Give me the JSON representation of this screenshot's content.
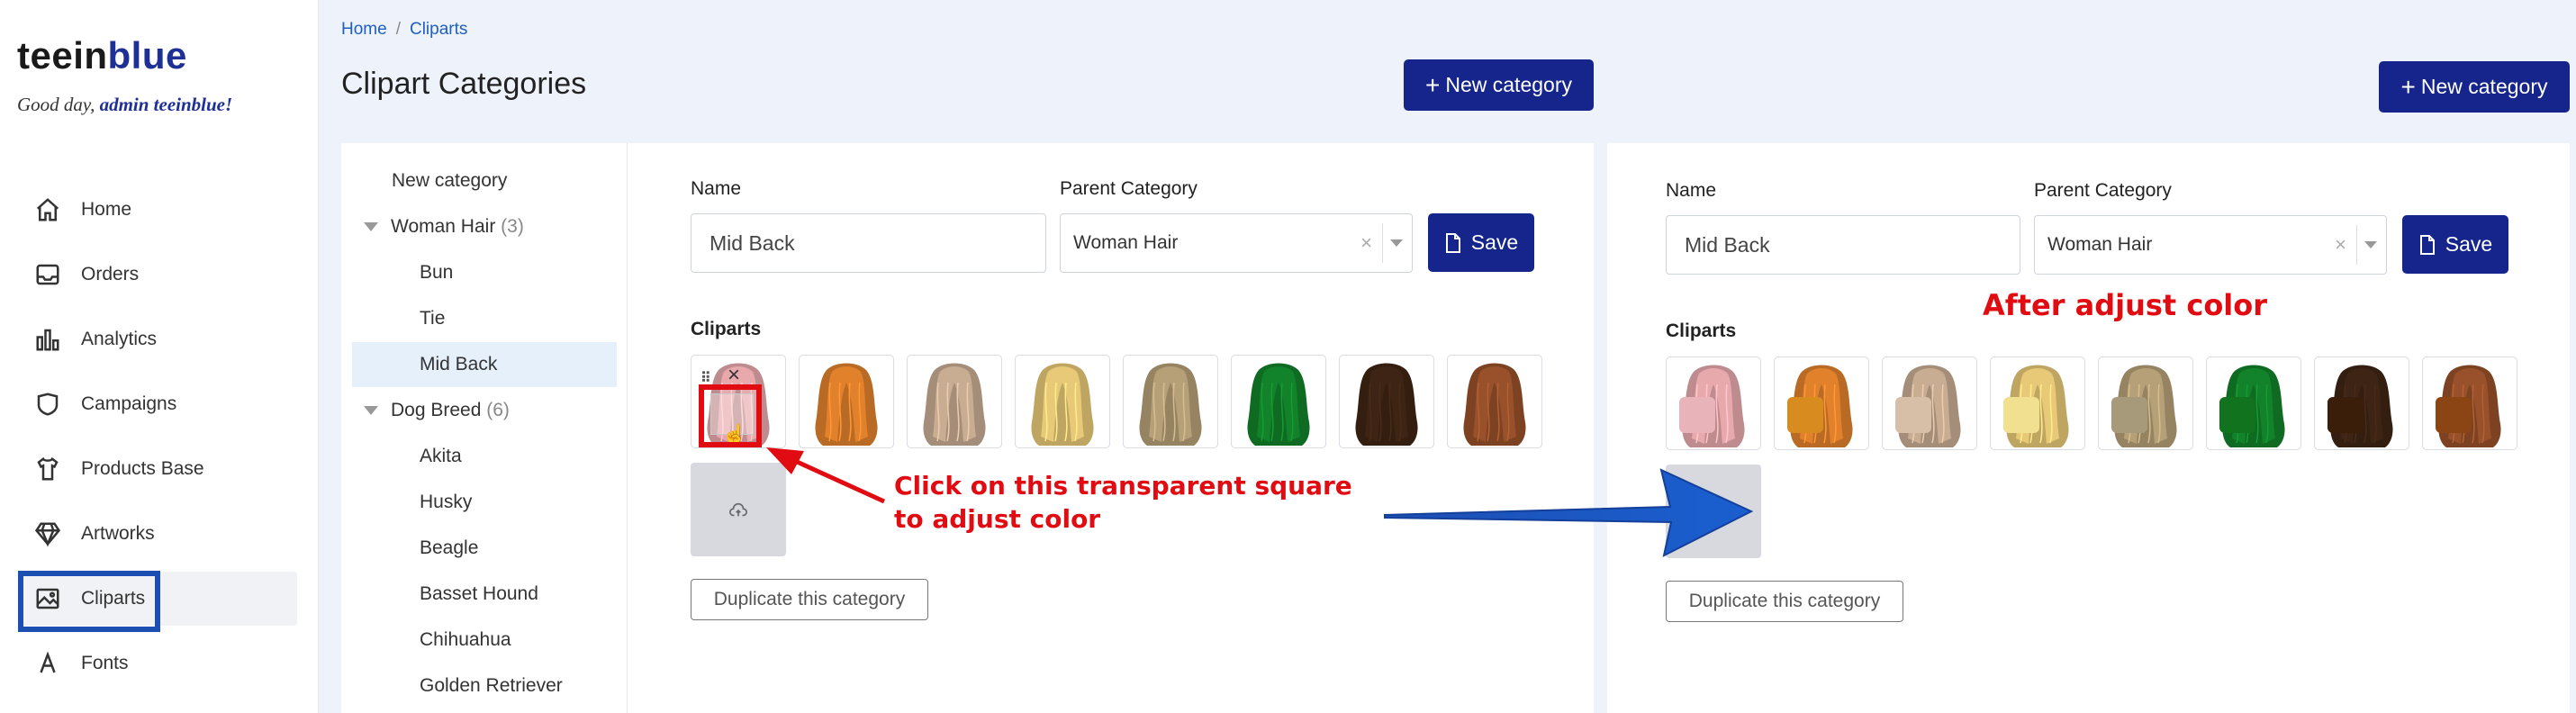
{
  "brand": {
    "part1": "teein",
    "part2": "blue"
  },
  "greeting": {
    "prefix": "Good day, ",
    "user": "admin teeinblue!"
  },
  "nav": [
    {
      "label": "Home",
      "icon": "home-icon"
    },
    {
      "label": "Orders",
      "icon": "inbox-icon"
    },
    {
      "label": "Analytics",
      "icon": "bar-chart-icon"
    },
    {
      "label": "Campaigns",
      "icon": "campaign-icon"
    },
    {
      "label": "Products Base",
      "icon": "shirt-icon"
    },
    {
      "label": "Artworks",
      "icon": "gem-icon"
    },
    {
      "label": "Cliparts",
      "icon": "image-icon",
      "active": true
    },
    {
      "label": "Fonts",
      "icon": "font-icon"
    }
  ],
  "breadcrumb": {
    "home": "Home",
    "sep": "/",
    "current": "Cliparts"
  },
  "page_title": "Clipart Categories",
  "new_category_button": "New category",
  "tree": {
    "new_category": "New category",
    "groups": [
      {
        "label": "Woman Hair",
        "count": "(3)",
        "children": [
          "Bun",
          "Tie",
          "Mid Back"
        ]
      },
      {
        "label": "Dog Breed",
        "count": "(6)",
        "children": [
          "Akita",
          "Husky",
          "Beagle",
          "Basset Hound",
          "Chihuahua",
          "Golden Retriever"
        ]
      }
    ],
    "selected": "Mid Back"
  },
  "form": {
    "name_label": "Name",
    "name_value": "Mid Back",
    "parent_label": "Parent Category",
    "parent_value": "Woman Hair",
    "clear_symbol": "×",
    "save_label": "Save",
    "cliparts_label": "Cliparts",
    "duplicate_label": "Duplicate this category"
  },
  "hair_colors": [
    "#e8a9ad",
    "#e2812c",
    "#c9ad93",
    "#e8c977",
    "#b6a078",
    "#12832a",
    "#3e2414",
    "#98512a"
  ],
  "adjusted_swatches": [
    "#e9b4b9",
    "#d88b1e",
    "#d6bfa6",
    "#f0e08f",
    "#a79a7a",
    "#11731d",
    "#3a1e0a",
    "#8b4414"
  ],
  "annotations": {
    "click_line1": "Click on this transparent square",
    "click_line2": "to adjust color",
    "after": "After adjust color",
    "accent": "#e10b12",
    "arrow_color": "#1d4fb3"
  }
}
